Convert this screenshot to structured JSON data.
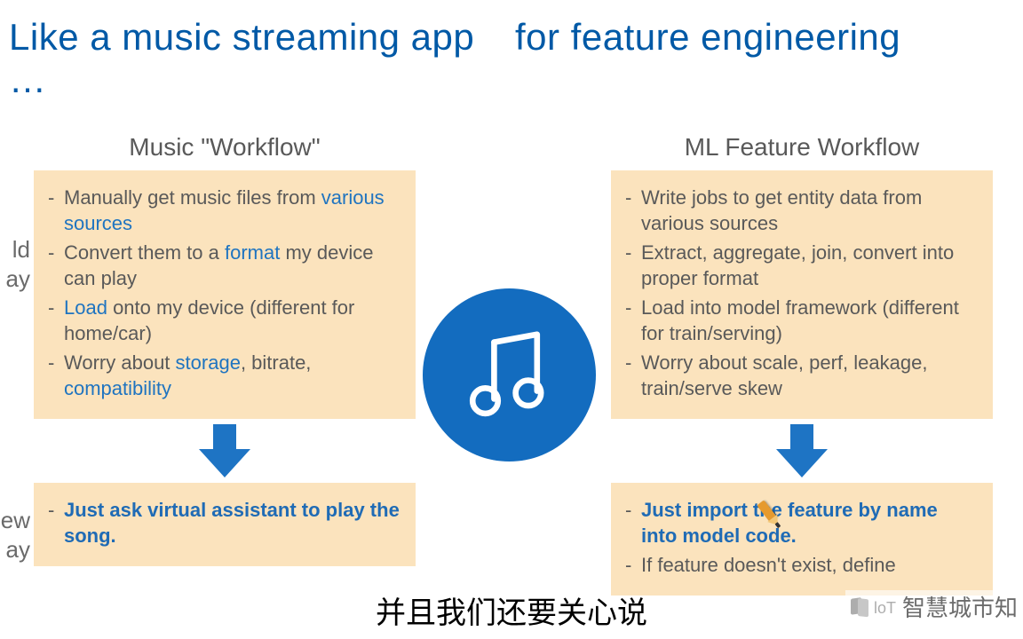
{
  "title": {
    "left": "Like a music streaming app …",
    "right": "for feature engineering"
  },
  "sideLabels": {
    "oldTop": "ld",
    "oldBottom": "ay",
    "newTop": "ew",
    "newBottom": "ay"
  },
  "left": {
    "subhead": "Music \"Workflow\"",
    "old": {
      "i1a": "Manually get music files from ",
      "i1b": "various sources",
      "i2a": "Convert them to a ",
      "i2b": "format",
      "i2c": " my device can play",
      "i3a": "Load",
      "i3b": " onto my device (different for home/car)",
      "i4a": "Worry about ",
      "i4b": "storage",
      "i4c": ", bitrate, ",
      "i4d": "compatibility"
    },
    "new": {
      "line": "Just ask virtual assistant to play the song."
    }
  },
  "right": {
    "subhead": "ML Feature Workflow",
    "old": {
      "i1": "Write jobs to get entity data from various sources",
      "i2": "Extract, aggregate, join, convert into proper format",
      "i3": "Load into model framework (different for train/serving)",
      "i4": "Worry about scale, perf, leakage, train/serve skew"
    },
    "new": {
      "line1": "Just import the feature by name into model code.",
      "line2": "If feature doesn't exist, define"
    }
  },
  "subtitle": "并且我们还要关心说",
  "watermark": "智慧城市知",
  "colors": {
    "accent": "#136cbf",
    "boxBg": "#fbe3bd",
    "heading": "#0059a6",
    "body": "#595959",
    "keyword": "#1f74c0"
  }
}
